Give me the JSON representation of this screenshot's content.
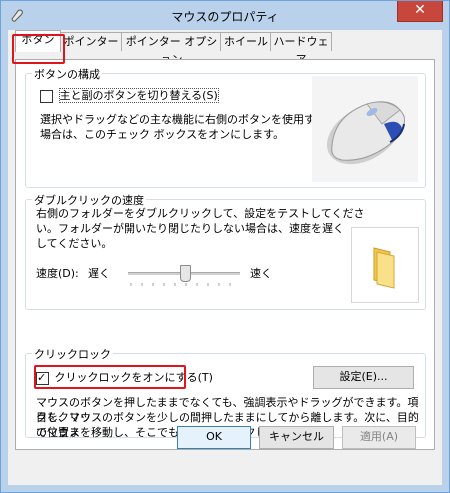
{
  "window": {
    "title": "マウスのプロパティ",
    "close_label": "✕"
  },
  "tabs": [
    {
      "label": "ボタン"
    },
    {
      "label": "ポインター"
    },
    {
      "label": "ポインター オプション"
    },
    {
      "label": "ホイール"
    },
    {
      "label": "ハードウェア"
    }
  ],
  "button_config": {
    "title": "ボタンの構成",
    "switch_label": "主と副のボタンを切り替える(S)",
    "switch_checked": false,
    "description": [
      "選択やドラッグなどの主な機能に右側のボタンを使用する",
      "場合は、このチェック ボックスをオンにします。"
    ]
  },
  "double_click": {
    "title": "ダブルクリックの速度",
    "description": [
      "右側のフォルダーをダブルクリックして、設定をテストしてくださ",
      "い。フォルダーが開いたり閉じたりしない場合は、速度を遅く",
      "してください。"
    ],
    "speed_label": "速度(D):",
    "slow_label": "遅く",
    "fast_label": "速く",
    "speed_value": 0.5
  },
  "click_lock": {
    "title": "クリックロック",
    "checkbox_label": "クリックロックをオンにする(T)",
    "checkbox_checked": true,
    "settings_button": "設定(E)...",
    "description": [
      "マウスのボタンを押したままでなくても、強調表示やドラッグができます。項目をクリッ",
      "クし、マウスのボタンを少しの間押したままにしてから離します。次に、目的の位置ま",
      "でマウスを移動し、そこでもう一度クリックします。"
    ]
  },
  "footer": {
    "ok": "OK",
    "cancel": "キャンセル",
    "apply": "適用(A)"
  },
  "colors": {
    "highlight": "#e0141b",
    "title_bar": "#b9d1ea",
    "close_button": "#c7473c"
  }
}
